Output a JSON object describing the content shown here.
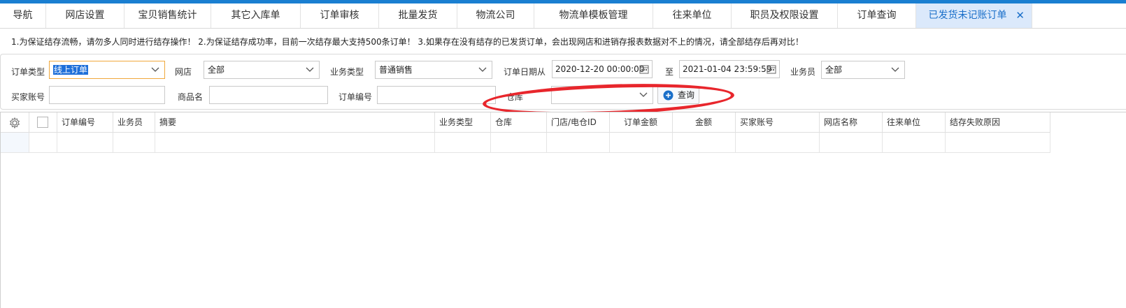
{
  "tabs": [
    {
      "label": "导航"
    },
    {
      "label": "网店设置"
    },
    {
      "label": "宝贝销售统计"
    },
    {
      "label": "其它入库单"
    },
    {
      "label": "订单审核"
    },
    {
      "label": "批量发货"
    },
    {
      "label": "物流公司"
    },
    {
      "label": "物流单模板管理"
    },
    {
      "label": "往来单位"
    },
    {
      "label": "职员及权限设置"
    },
    {
      "label": "订单查询"
    },
    {
      "label": "已发货未记账订单",
      "close": "✕"
    }
  ],
  "notice": "1.为保证结存流畅，请勿多人同时进行结存操作！ 2.为保证结存成功率，目前一次结存最大支持500条订单！ 3.如果存在没有结存的已发货订单，会出现网店和进销存报表数据对不上的情况，请全部结存后再对比！",
  "filters": {
    "order_type": {
      "label": "订单类型",
      "value": "线上订单"
    },
    "shop": {
      "label": "网店",
      "value": "全部"
    },
    "biz_type": {
      "label": "业务类型",
      "value": "普通销售"
    },
    "date": {
      "label": "订单日期从",
      "from": "2020-12-20 00:00:00",
      "to_label": "至",
      "to": "2021-01-04 23:59:59"
    },
    "salesman": {
      "label": "业务员",
      "value": "全部"
    },
    "buyer": {
      "label": "买家账号",
      "value": ""
    },
    "product": {
      "label": "商品名",
      "value": ""
    },
    "order_no": {
      "label": "订单编号",
      "value": ""
    },
    "warehouse": {
      "label": "仓库",
      "value": ""
    },
    "query_button": "查询"
  },
  "grid": {
    "columns": [
      "订单编号",
      "业务员",
      "摘要",
      "业务类型",
      "仓库",
      "门店/电仓ID",
      "订单金额",
      "金额",
      "买家账号",
      "网店名称",
      "往来单位",
      "结存失败原因"
    ]
  },
  "colors": {
    "accent": "#1a7fd1",
    "active_tab_bg": "#dbe9fb",
    "highlight_oval": "#e8262c"
  }
}
